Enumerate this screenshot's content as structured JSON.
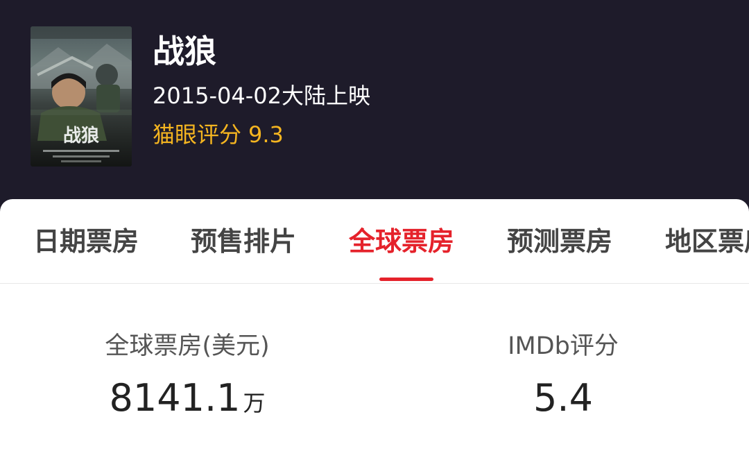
{
  "movie": {
    "title": "战狼",
    "release": "2015-04-02大陆上映",
    "score_label": "猫眼评分",
    "score_value": "9.3",
    "poster_title": "战狼"
  },
  "tabs": [
    {
      "label": "日期票房",
      "active": false
    },
    {
      "label": "预售排片",
      "active": false
    },
    {
      "label": "全球票房",
      "active": true
    },
    {
      "label": "预测票房",
      "active": false
    },
    {
      "label": "地区票房",
      "active": false
    }
  ],
  "stats": {
    "global_box_office": {
      "label": "全球票房(美元)",
      "value": "8141.1",
      "unit": "万"
    },
    "imdb": {
      "label": "IMDb评分",
      "value": "5.4"
    }
  },
  "colors": {
    "header_bg": "#1e1b2a",
    "accent_red": "#e5222b",
    "score_gold": "#f5b520"
  }
}
